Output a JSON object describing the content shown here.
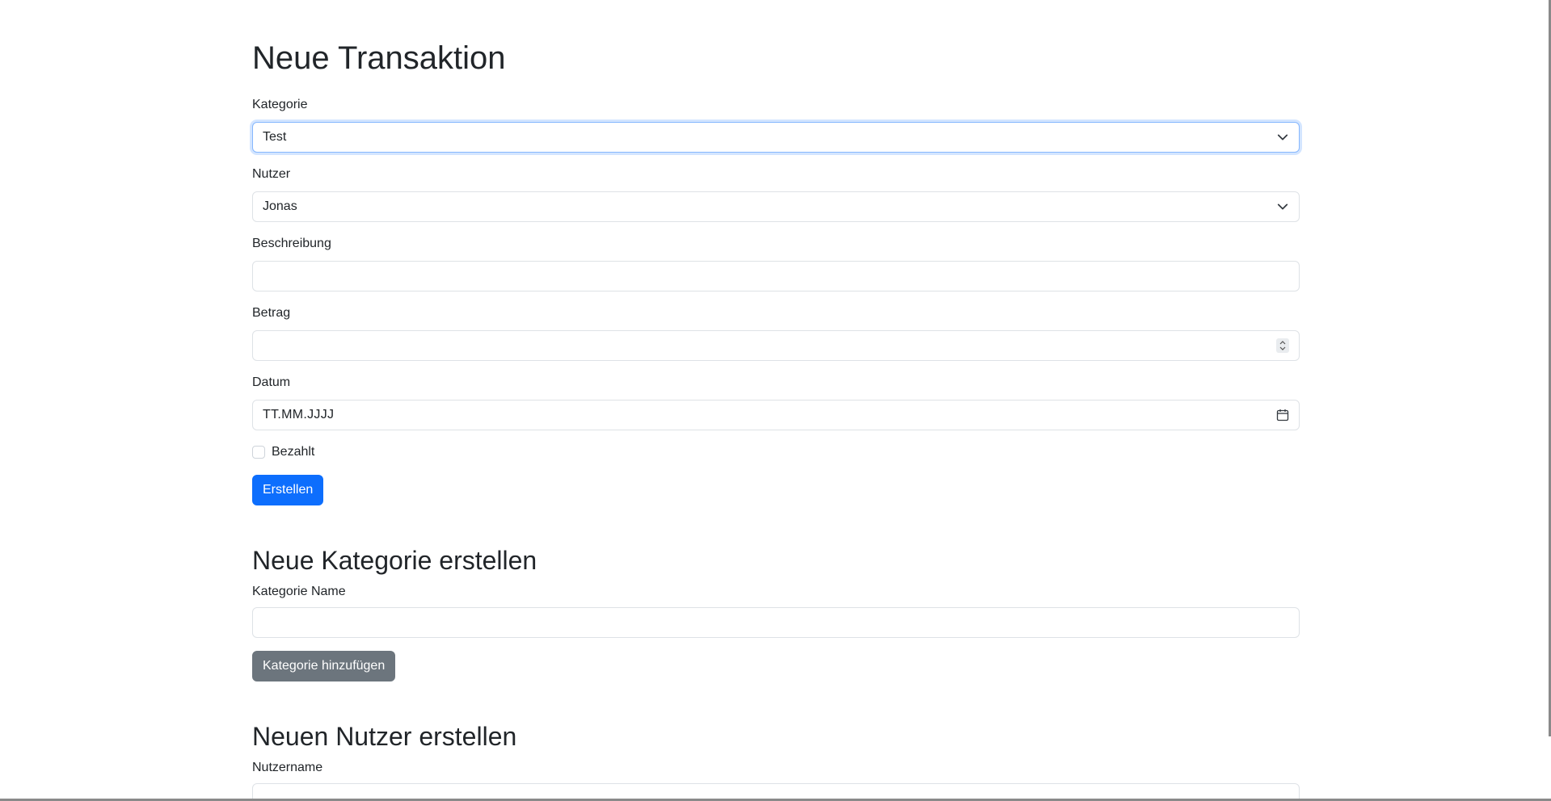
{
  "transaction": {
    "title": "Neue Transaktion",
    "category_label": "Kategorie",
    "category_value": "Test",
    "user_label": "Nutzer",
    "user_value": "Jonas",
    "description_label": "Beschreibung",
    "description_value": "",
    "amount_label": "Betrag",
    "amount_value": "",
    "date_label": "Datum",
    "date_placeholder": "TT.MM.JJJJ",
    "paid_label": "Bezahlt",
    "paid_checked": false,
    "submit_label": "Erstellen"
  },
  "category": {
    "title": "Neue Kategorie erstellen",
    "name_label": "Kategorie Name",
    "name_value": "",
    "submit_label": "Kategorie hinzufügen"
  },
  "user": {
    "title": "Neuen Nutzer erstellen",
    "name_label": "Nutzername",
    "name_value": ""
  },
  "colors": {
    "primary": "#0d6efd",
    "secondary": "#6c757d",
    "focus_border": "#86b7fe",
    "text": "#212529",
    "border": "#dee2e6"
  },
  "icons": {
    "select": "chevron-down-icon",
    "number": "spinner-icon",
    "date": "calendar-icon"
  }
}
